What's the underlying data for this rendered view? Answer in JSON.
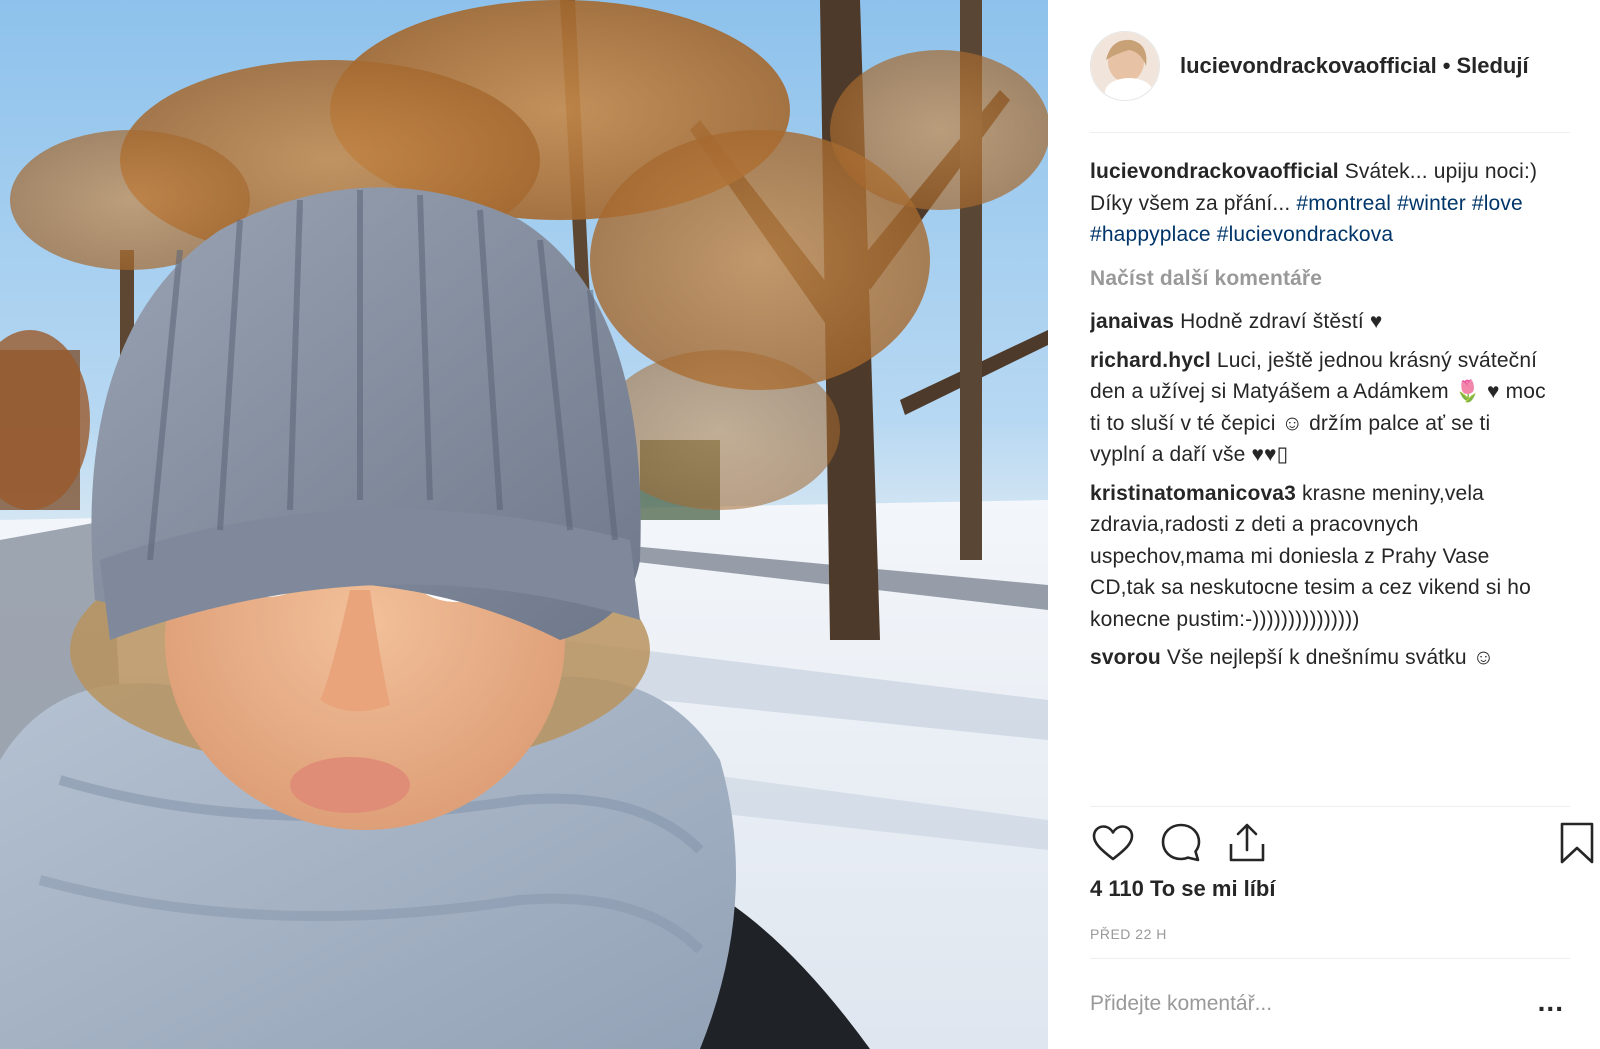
{
  "post": {
    "username": "lucievondrackovaofficial",
    "separator": "•",
    "follow_label": "Sledují",
    "caption": {
      "user": "lucievondrackovaofficial",
      "text": "Svátek... upiju noci:) Díky všem za přání...",
      "hashtags": [
        "#montreal",
        "#winter",
        "#love",
        "#happyplace",
        "#lucievondrackova"
      ]
    },
    "load_more_label": "Načíst další komentáře",
    "comments": [
      {
        "user": "janaivas",
        "text": "Hodně zdraví štěstí ♥"
      },
      {
        "user": "richard.hycl",
        "text": "Luci, ještě jednou krásný sváteční den a užívej si Matyášem a Adámkem 🌷 ♥ moc ti to sluší v té čepici ☺ držím palce ať se ti vyplní a daří vše ♥♥▯"
      },
      {
        "user": "kristinatomanicova3",
        "text": "krasne meniny,vela zdravia,radosti z deti a pracovnych uspechov,mama mi doniesla z Prahy Vase CD,tak sa neskutocne tesim a cez vikend si ho konecne pustim:-)))))))))))))))"
      },
      {
        "user": "svorou",
        "text": "Vše nejlepší k dnešnímu svátku ☺"
      }
    ],
    "likes_label": "4 110 To se mi líbí",
    "time_label": "PŘED 22 H",
    "add_comment_placeholder": "Přidejte komentář...",
    "more_label": "..."
  },
  "icons": {
    "like": "heart-outline-icon",
    "comment": "speech-bubble-icon",
    "share": "share-upload-icon",
    "save": "bookmark-icon",
    "comment_like": "small-heart-icon"
  },
  "colors": {
    "text": "#262626",
    "muted": "#999999",
    "hashtag": "#003569",
    "divider": "#efefef"
  }
}
